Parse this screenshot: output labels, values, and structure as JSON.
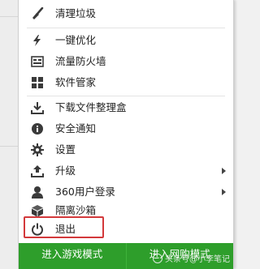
{
  "menu": {
    "items": [
      {
        "label": "清理垃圾",
        "icon": "broom-icon"
      },
      {
        "label": "一键优化",
        "icon": "lightning-icon"
      },
      {
        "label": "流量防火墙",
        "icon": "firewall-icon"
      },
      {
        "label": "软件管家",
        "icon": "apps-grid-icon"
      },
      {
        "label": "下载文件整理盒",
        "icon": "download-icon"
      },
      {
        "label": "安全通知",
        "icon": "info-icon"
      },
      {
        "label": "设置",
        "icon": "gear-icon"
      },
      {
        "label": "升级",
        "icon": "upgrade-icon"
      },
      {
        "label": "360用户登录",
        "icon": "user-icon"
      },
      {
        "label": "隔离沙箱",
        "icon": "sandbox-box-icon"
      },
      {
        "label": "退出",
        "icon": "power-icon"
      }
    ]
  },
  "bottom": {
    "game_mode_label": "进入游戏模式",
    "network_mode_label": "进入网购模式"
  },
  "watermark": {
    "text": "头条号@小李笔记"
  },
  "colors": {
    "bottom_bar": "#2e9e2b",
    "highlight_border": "#d3393b",
    "icon": "#3a3a3a"
  }
}
